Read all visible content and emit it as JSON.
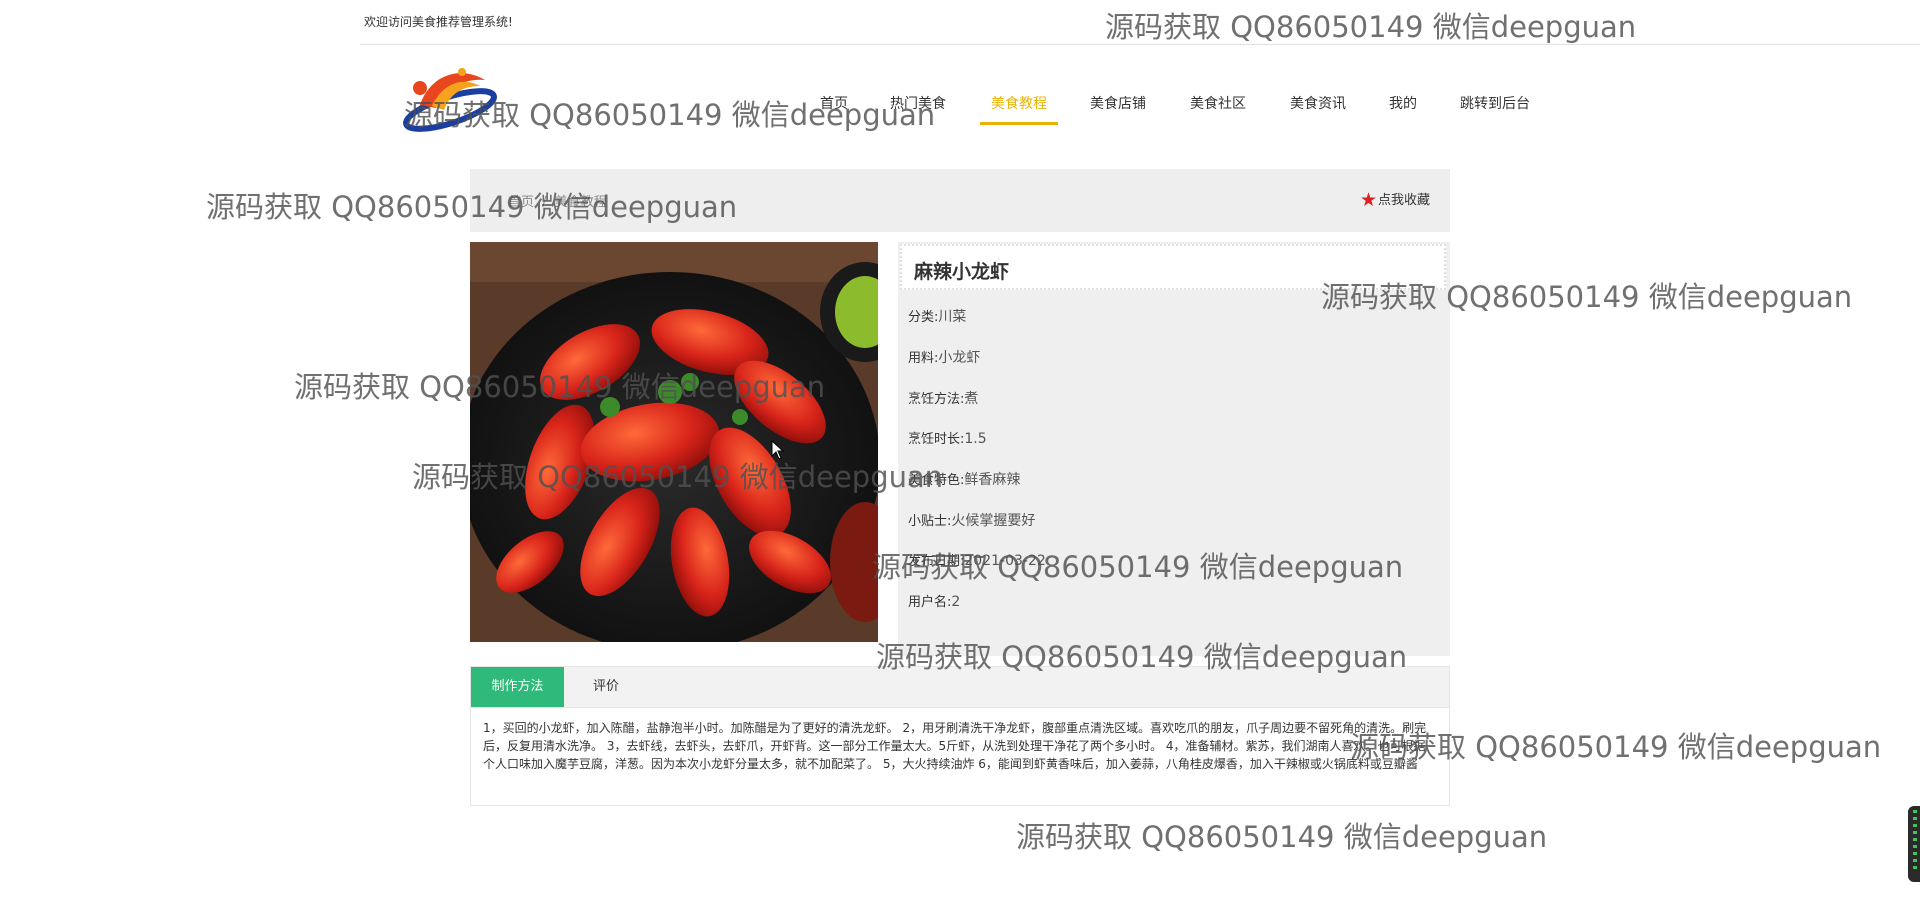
{
  "header": {
    "welcome": "欢迎访问美食推荐管理系统!"
  },
  "nav": {
    "items": [
      {
        "label": "首页",
        "active": false
      },
      {
        "label": "热门美食",
        "active": false
      },
      {
        "label": "美食教程",
        "active": true
      },
      {
        "label": "美食店铺",
        "active": false
      },
      {
        "label": "美食社区",
        "active": false
      },
      {
        "label": "美食资讯",
        "active": false
      },
      {
        "label": "我的",
        "active": false
      },
      {
        "label": "跳转到后台",
        "active": false
      }
    ],
    "active_color": "#eab30a"
  },
  "breadcrumb": {
    "home": "首页",
    "separator": "/",
    "current": "美食教程"
  },
  "collect": {
    "icon": "star-icon",
    "label": "点我收藏",
    "icon_color": "#e02020"
  },
  "dish": {
    "title": "麻辣小龙虾",
    "fields": [
      {
        "label": "分类:",
        "value": "川菜"
      },
      {
        "label": "用料:",
        "value": "小龙虾"
      },
      {
        "label": "烹饪方法:",
        "value": "煮"
      },
      {
        "label": "烹饪时长:",
        "value": "1.5"
      },
      {
        "label": "美食特色:",
        "value": "鲜香麻辣"
      },
      {
        "label": "小贴士:",
        "value": "火候掌握要好"
      },
      {
        "label": "发布日期:",
        "value": "2021-03-22"
      },
      {
        "label": "用户名:",
        "value": "2"
      }
    ]
  },
  "tabs": {
    "items": [
      "制作方法",
      "评价"
    ],
    "active_color": "#2fb97a",
    "method_text": "1，买回的小龙虾，加入陈醋，盐静泡半小时。加陈醋是为了更好的清洗龙虾。 2，用牙刷清洗干净龙虾，腹部重点清洗区域。喜欢吃爪的朋友，爪子周边要不留死角的清洗。刷完后，反复用清水洗净。 3，去虾线，去虾头，去虾爪，开虾背。这一部分工作量太大。5斤虾，从洗到处理干净花了两个多小时。 4，准备辅材。紫苏，我们湖南人喜欢。也可根据个人口味加入魔芋豆腐，洋葱。因为本次小龙虾分量太多，就不加配菜了。 5，大火持续油炸 6，能闻到虾黄香味后，加入姜蒜，八角桂皮爆香，加入干辣椒或火锅底料或豆瓣酱"
  },
  "watermark": "源码获取 QQ86050149 微信deepguan"
}
